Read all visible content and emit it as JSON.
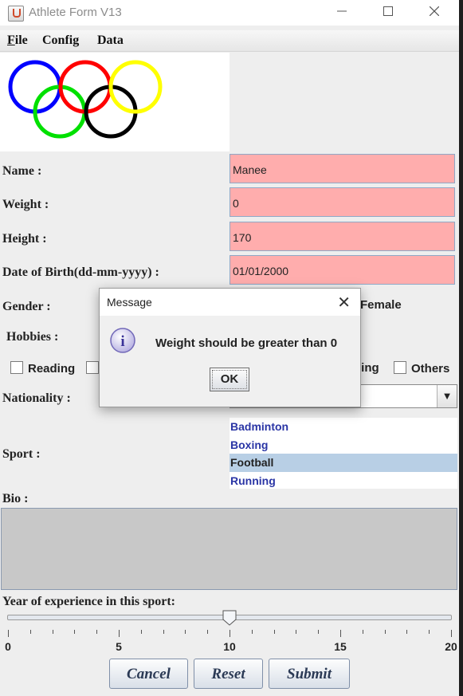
{
  "window": {
    "title": "Athlete Form V13",
    "minimize_icon": "minimize-icon",
    "maximize_icon": "maximize-icon",
    "close_icon": "close-icon"
  },
  "menu": [
    "File",
    "Config",
    "Data"
  ],
  "logo": {
    "ring_colors": [
      "#0000ff",
      "#00e000",
      "#ff0000",
      "#000000",
      "#ffff00"
    ]
  },
  "form": {
    "name_label": "Name :",
    "name_value": "Manee",
    "weight_label": "Weight :",
    "weight_value": "0",
    "height_label": "Height :",
    "height_value": "170",
    "dob_label": "Date of Birth(dd-mm-yyyy) :",
    "dob_value": "01/01/2000",
    "gender_label": "Gender :",
    "gender_visible_option": "Female",
    "hobbies_label": "Hobbies :",
    "hobbies": [
      "Reading",
      "ping",
      "Others"
    ],
    "nationality_label": "Nationality :",
    "nationality_value": "",
    "sport_label": "Sport :",
    "sports": [
      "Badminton",
      "Boxing",
      "Football",
      "Running"
    ],
    "sport_selected": "Football",
    "bio_label": "Bio :",
    "bio_value": "",
    "experience_label": "Year of experience in this sport:",
    "experience_value": 10,
    "experience_ticks": [
      "0",
      "5",
      "10",
      "15",
      "20"
    ],
    "field_color": "#ffadad"
  },
  "buttons": {
    "cancel": "Cancel",
    "reset": "Reset",
    "submit": "Submit"
  },
  "dialog": {
    "title": "Message",
    "message": "Weight should be greater than 0",
    "ok": "OK",
    "icon": "info-icon"
  }
}
